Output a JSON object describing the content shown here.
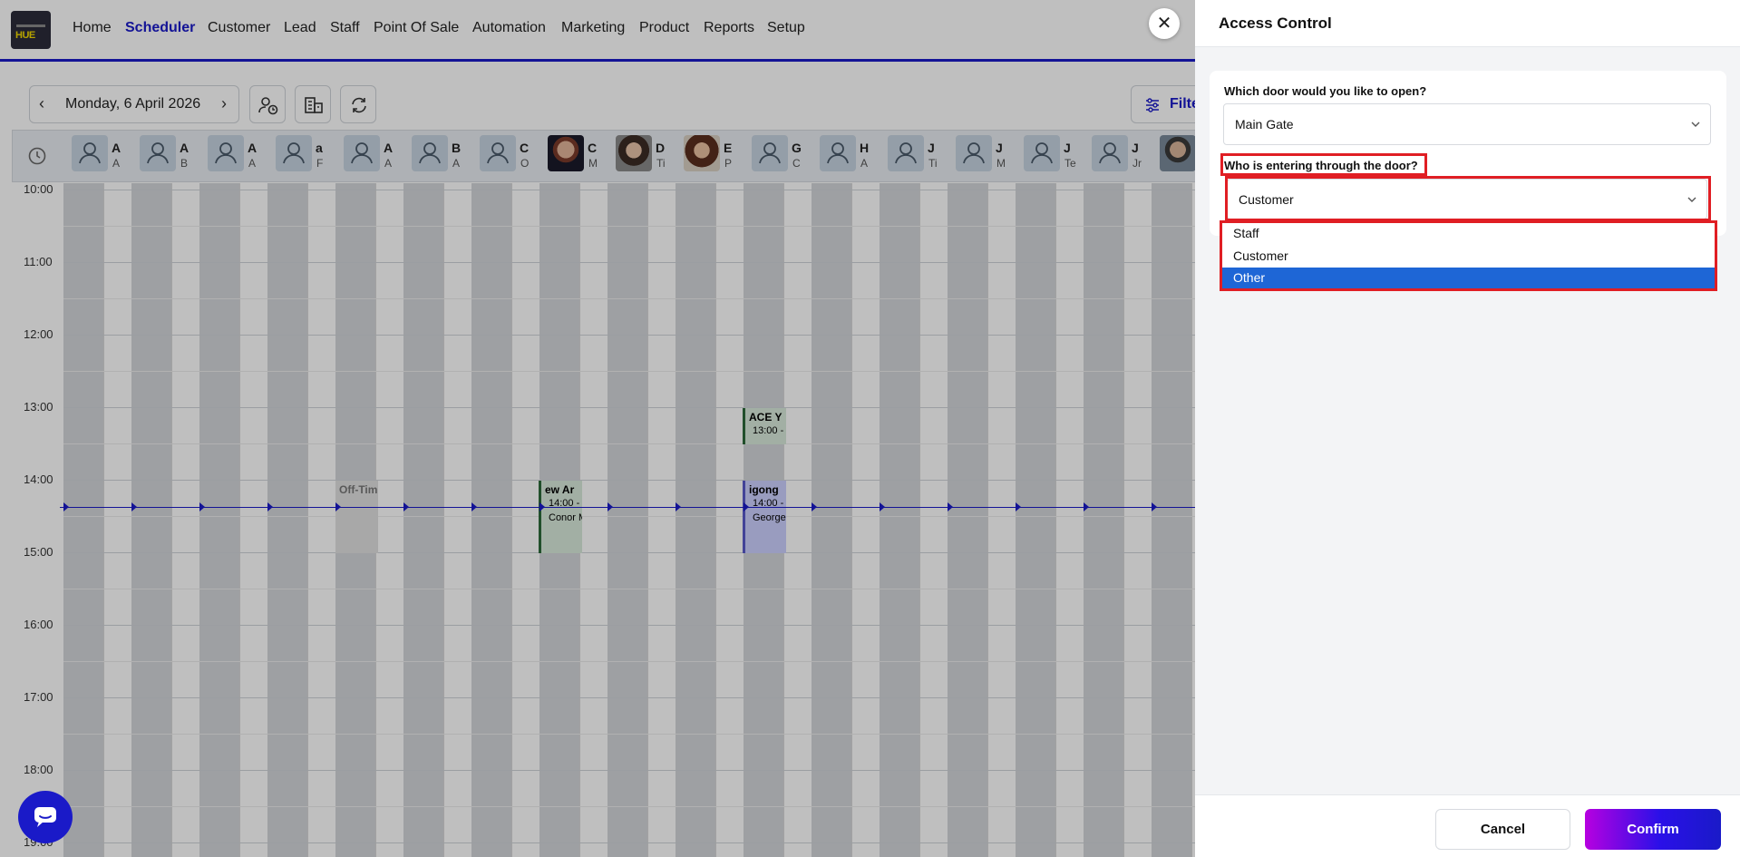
{
  "nav": {
    "logo_text": "HUE",
    "items": [
      "Home",
      "Scheduler",
      "Customer",
      "Lead",
      "Staff",
      "Point Of Sale",
      "Automation",
      "Marketing",
      "Product",
      "Reports",
      "Setup"
    ],
    "active": "Scheduler"
  },
  "scheduler": {
    "date": "Monday, 6 April 2026",
    "filter_label": "Filte",
    "staff": [
      {
        "initial": "A",
        "sub": "A"
      },
      {
        "initial": "A",
        "sub": "B"
      },
      {
        "initial": "A",
        "sub": "A"
      },
      {
        "initial": "a",
        "sub": "F"
      },
      {
        "initial": "A",
        "sub": "A"
      },
      {
        "initial": "B",
        "sub": "A"
      },
      {
        "initial": "C",
        "sub": "O"
      },
      {
        "initial": "C",
        "sub": "M"
      },
      {
        "initial": "D",
        "sub": "Ti"
      },
      {
        "initial": "E",
        "sub": "P"
      },
      {
        "initial": "G",
        "sub": "C"
      },
      {
        "initial": "H",
        "sub": "A"
      },
      {
        "initial": "J",
        "sub": "Ti"
      },
      {
        "initial": "J",
        "sub": "M"
      },
      {
        "initial": "J",
        "sub": "Te"
      },
      {
        "initial": "J",
        "sub": "Jr"
      },
      {
        "initial": "",
        "sub": ""
      }
    ],
    "times": [
      "10:00",
      "11:00",
      "12:00",
      "13:00",
      "14:00",
      "15:00",
      "16:00",
      "17:00",
      "18:00",
      "19:00"
    ],
    "events": [
      {
        "title": "Off-Tim",
        "range": "",
        "person": ""
      },
      {
        "title": "ew Ar",
        "range": "14:00 -",
        "person": "Conor M"
      },
      {
        "title": "ACE Y",
        "range": "13:00 -",
        "person": ""
      },
      {
        "title": "igong",
        "range": "14:00 -",
        "person": "George"
      }
    ]
  },
  "panel": {
    "title": "Access Control",
    "door_label": "Which door would you like to open?",
    "door_value": "Main Gate",
    "who_label": "Who is entering through the door?",
    "who_value": "Customer",
    "options": [
      "Staff",
      "Customer",
      "Other"
    ],
    "highlighted_option": "Other",
    "cancel": "Cancel",
    "confirm": "Confirm"
  },
  "colors": {
    "accent": "#1a1ac8",
    "highlight": "#e01e24",
    "selected": "#1e66d6"
  }
}
